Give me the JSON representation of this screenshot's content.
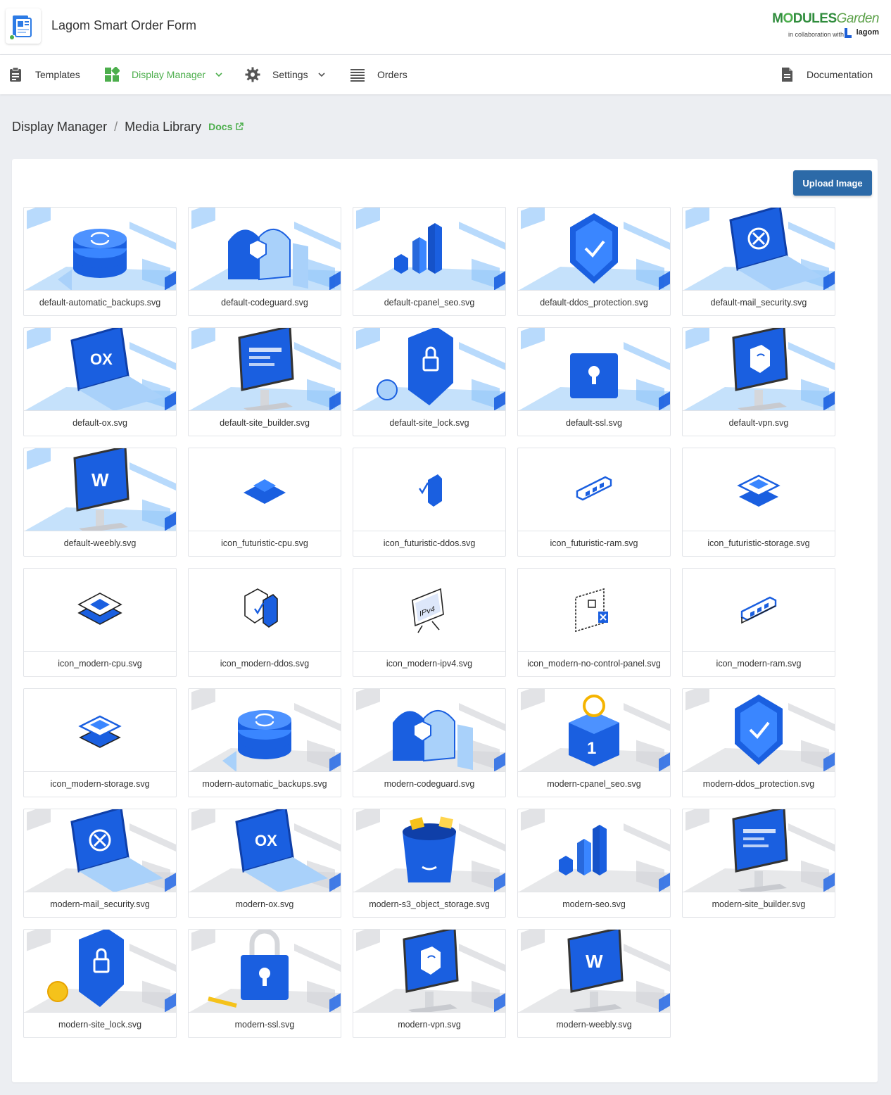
{
  "app": {
    "title": "Lagom Smart Order Form"
  },
  "brand": {
    "main_a": "M",
    "main_b": "DULES",
    "main_c": "Garden",
    "sub": "in collaboration with",
    "partner": "lagom"
  },
  "nav": {
    "templates": "Templates",
    "display_manager": "Display Manager",
    "settings": "Settings",
    "orders": "Orders",
    "documentation": "Documentation"
  },
  "breadcrumb": {
    "parent": "Display Manager",
    "separator": "/",
    "current": "Media Library",
    "docs": "Docs"
  },
  "toolbar": {
    "upload_label": "Upload Image"
  },
  "colors": {
    "accent_green": "#4cae4c",
    "primary_blue": "#2c6aa8",
    "illustration_blue": "#1a5fe0",
    "illustration_light": "#a9d1fa"
  },
  "images": [
    {
      "name": "default-automatic_backups.svg",
      "style": "default",
      "icon": "database-sync-icon"
    },
    {
      "name": "default-codeguard.svg",
      "style": "default",
      "icon": "mailbox-shield-icon"
    },
    {
      "name": "default-cpanel_seo.svg",
      "style": "default",
      "icon": "bar-chart-icon"
    },
    {
      "name": "default-ddos_protection.svg",
      "style": "default",
      "icon": "shield-check-icon"
    },
    {
      "name": "default-mail_security.svg",
      "style": "default",
      "icon": "laptop-mail-icon"
    },
    {
      "name": "default-ox.svg",
      "style": "default",
      "icon": "laptop-ox-icon"
    },
    {
      "name": "default-site_builder.svg",
      "style": "default",
      "icon": "monitor-builder-icon"
    },
    {
      "name": "default-site_lock.svg",
      "style": "default",
      "icon": "shield-lock-icon"
    },
    {
      "name": "default-ssl.svg",
      "style": "default",
      "icon": "padlock-icon"
    },
    {
      "name": "default-vpn.svg",
      "style": "default",
      "icon": "monitor-vpn-icon"
    },
    {
      "name": "default-weebly.svg",
      "style": "default",
      "icon": "monitor-weebly-icon"
    },
    {
      "name": "icon_futuristic-cpu.svg",
      "style": "futuristic",
      "icon": "cpu-icon"
    },
    {
      "name": "icon_futuristic-ddos.svg",
      "style": "futuristic",
      "icon": "ddos-tag-icon"
    },
    {
      "name": "icon_futuristic-ram.svg",
      "style": "futuristic",
      "icon": "ram-icon"
    },
    {
      "name": "icon_futuristic-storage.svg",
      "style": "futuristic",
      "icon": "storage-icon"
    },
    {
      "name": "icon_modern-cpu.svg",
      "style": "modern-icon",
      "icon": "cpu-icon"
    },
    {
      "name": "icon_modern-ddos.svg",
      "style": "modern-icon",
      "icon": "ddos-tag-icon"
    },
    {
      "name": "icon_modern-ipv4.svg",
      "style": "modern-icon",
      "icon": "ipv4-board-icon"
    },
    {
      "name": "icon_modern-no-control-panel.svg",
      "style": "modern-icon",
      "icon": "no-control-panel-icon"
    },
    {
      "name": "icon_modern-ram.svg",
      "style": "modern-icon",
      "icon": "ram-icon"
    },
    {
      "name": "icon_modern-storage.svg",
      "style": "modern-icon",
      "icon": "storage-icon"
    },
    {
      "name": "modern-automatic_backups.svg",
      "style": "modern",
      "icon": "database-sync-icon"
    },
    {
      "name": "modern-codeguard.svg",
      "style": "modern",
      "icon": "mailbox-shield-icon"
    },
    {
      "name": "modern-cpanel_seo.svg",
      "style": "modern",
      "icon": "seo-cube-icon"
    },
    {
      "name": "modern-ddos_protection.svg",
      "style": "modern",
      "icon": "shield-check-icon"
    },
    {
      "name": "modern-mail_security.svg",
      "style": "modern",
      "icon": "laptop-mail-icon"
    },
    {
      "name": "modern-ox.svg",
      "style": "modern",
      "icon": "laptop-ox-icon"
    },
    {
      "name": "modern-s3_object_storage.svg",
      "style": "modern",
      "icon": "bucket-icon"
    },
    {
      "name": "modern-seo.svg",
      "style": "modern",
      "icon": "bar-chart-icon"
    },
    {
      "name": "modern-site_builder.svg",
      "style": "modern",
      "icon": "monitor-builder-icon"
    },
    {
      "name": "modern-site_lock.svg",
      "style": "modern",
      "icon": "shield-lock-icon"
    },
    {
      "name": "modern-ssl.svg",
      "style": "modern",
      "icon": "padlock-icon"
    },
    {
      "name": "modern-vpn.svg",
      "style": "modern",
      "icon": "monitor-vpn-icon"
    },
    {
      "name": "modern-weebly.svg",
      "style": "modern",
      "icon": "monitor-weebly-icon"
    }
  ]
}
